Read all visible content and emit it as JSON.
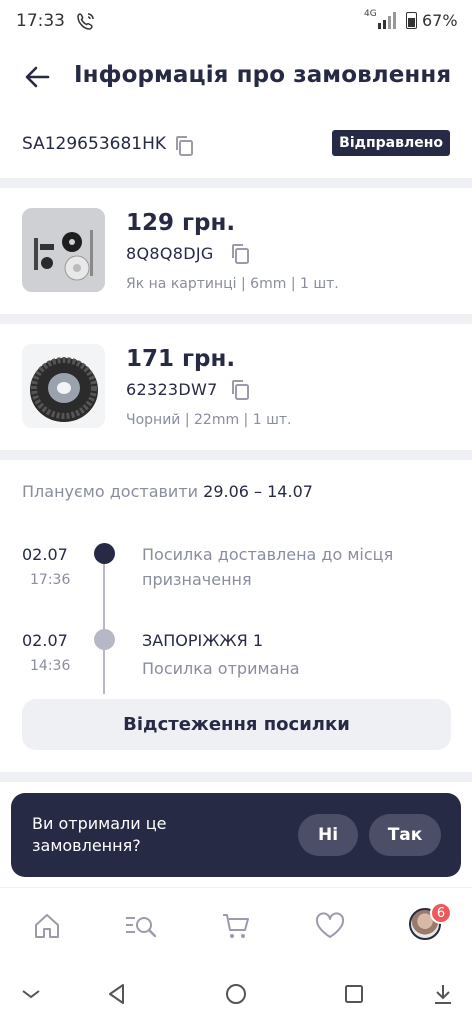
{
  "status_bar": {
    "time": "17:33",
    "network": "4G",
    "battery": "67%",
    "icons": [
      "call-icon",
      "signal-icon",
      "battery-icon"
    ]
  },
  "header": {
    "title": "Інформація про замовлення",
    "back_icon": "arrow-left-icon"
  },
  "order": {
    "id": "SA129653681HK",
    "status": "Відправлено"
  },
  "products": [
    {
      "price": "129 грн.",
      "sku": "8Q8Q8DJG",
      "variant": "Як на картинці | 6mm | 1 шт."
    },
    {
      "price": "171 грн.",
      "sku": "62323DW7",
      "variant": "Чорний | 22mm | 1 шт."
    }
  ],
  "delivery": {
    "plan_label": "Плануємо доставити",
    "plan_dates": "29.06 – 14.07",
    "events": [
      {
        "date": "02.07",
        "time": "17:36",
        "title": "",
        "text": "Посилка доставлена до місця призначення"
      },
      {
        "date": "02.07",
        "time": "14:36",
        "title": "ЗАПОРІЖЖЯ 1",
        "text": "Посилка отримана"
      }
    ],
    "track_button": "Відстеження посилки"
  },
  "prompt": {
    "question": "Ви отримали це замовлення?",
    "no": "Ні",
    "yes": "Так"
  },
  "tabbar": {
    "items": [
      "home-icon",
      "search-list-icon",
      "cart-icon",
      "heart-icon",
      "profile-avatar"
    ],
    "badge": "6"
  },
  "colors": {
    "primary": "#262a44",
    "muted": "#8a8d9e",
    "divider": "#eef0f4",
    "badge": "#ee5a5a"
  }
}
